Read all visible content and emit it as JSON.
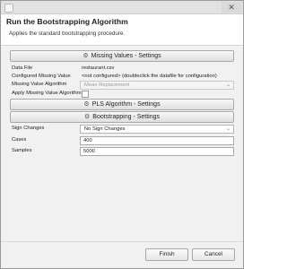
{
  "window": {
    "close_glyph": "✕"
  },
  "header": {
    "title": "Run the Bootstrapping Algorithm",
    "subtitle": "Applies the standard bootstrapping procedure."
  },
  "sections": {
    "missing_values": {
      "label": "Missing Values - Settings",
      "icon": "settings-icon"
    },
    "pls": {
      "label": "PLS Algorithm - Settings",
      "icon": "settings-icon"
    },
    "bootstrapping": {
      "label": "Bootstrapping - Settings",
      "icon": "settings-icon"
    }
  },
  "fields": {
    "data_file": {
      "label": "Data File",
      "value": "restaurant.csv"
    },
    "configured_missing": {
      "label": "Configured Missing Value",
      "value": "<not configured> (doubleclick the datafile for configuration)"
    },
    "missing_algorithm": {
      "label": "Missing Value Algorithm",
      "value": "Mean Replacement"
    },
    "apply_missing": {
      "label": "Apply Missing Value Algorithm"
    },
    "sign_changes": {
      "label": "Sign Changes",
      "value": "No Sign Changes"
    },
    "cases": {
      "label": "Cases",
      "value": "400"
    },
    "samples": {
      "label": "Samples",
      "value": "5000"
    }
  },
  "buttons": {
    "finish": "Finish",
    "cancel": "Cancel"
  }
}
